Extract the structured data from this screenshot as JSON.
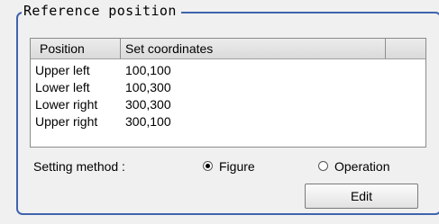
{
  "group": {
    "title": "Reference position"
  },
  "list": {
    "columns": [
      "Position",
      "Set coordinates",
      ""
    ],
    "rows": [
      {
        "position": "Upper left",
        "coordinates": "100,100"
      },
      {
        "position": "Lower left",
        "coordinates": "100,300"
      },
      {
        "position": "Lower right",
        "coordinates": "300,300"
      },
      {
        "position": "Upper right",
        "coordinates": "300,100"
      }
    ]
  },
  "setting_method": {
    "label": "Setting method :",
    "options": [
      {
        "label": "Figure",
        "selected": true
      },
      {
        "label": "Operation",
        "selected": false
      }
    ]
  },
  "buttons": {
    "edit_label": "Edit"
  },
  "colors": {
    "group_border": "#3f64ac",
    "background": "#f0f0f0"
  }
}
